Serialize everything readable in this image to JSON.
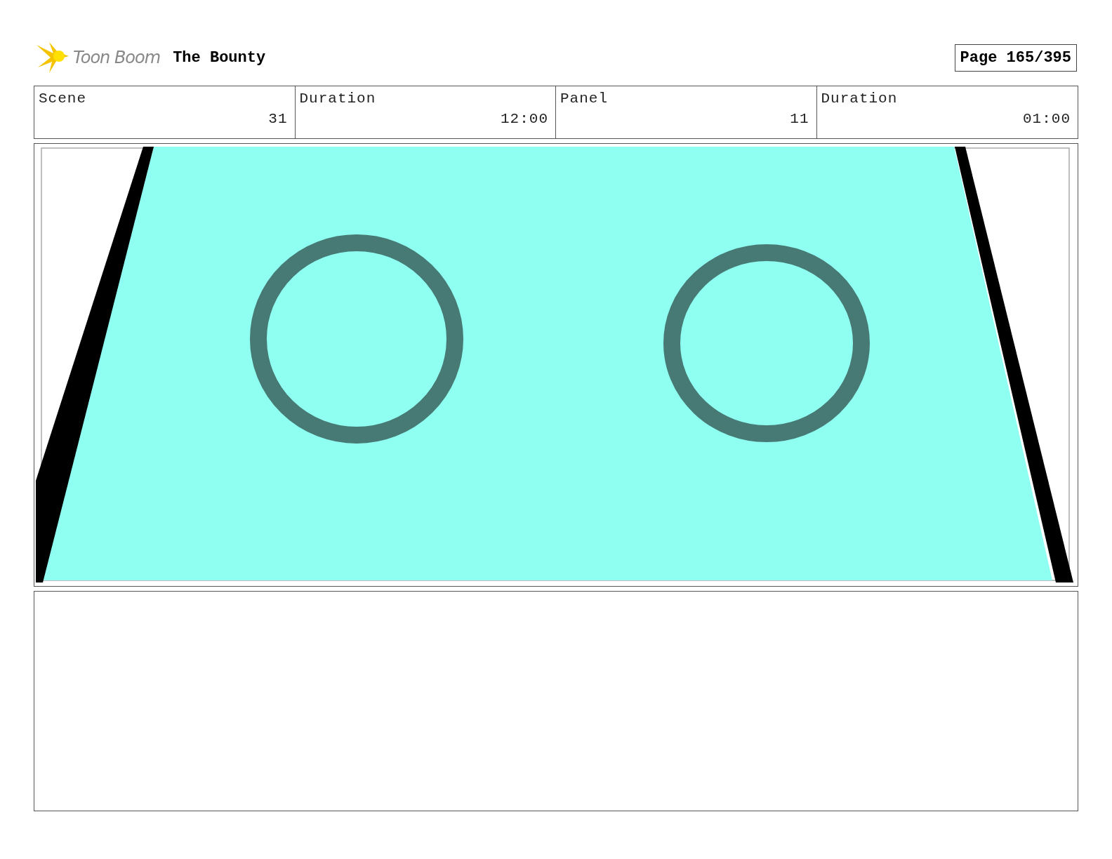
{
  "header": {
    "logo_text": "Toon Boom",
    "title": "The Bounty",
    "page": "Page 165/395"
  },
  "info_table": {
    "columns": [
      "Scene",
      "Duration",
      "Panel",
      "Duration"
    ],
    "rows": [
      [
        "31",
        "12:00",
        "11",
        "01:00"
      ]
    ]
  }
}
